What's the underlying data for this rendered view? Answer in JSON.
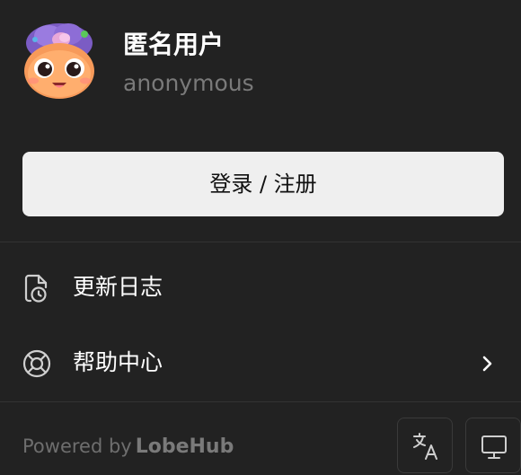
{
  "user": {
    "name": "匿名用户",
    "id": "anonymous"
  },
  "login": {
    "label": "登录 / 注册"
  },
  "menu": {
    "items": [
      {
        "label": "更新日志",
        "icon": "changelog-icon"
      },
      {
        "label": "帮助中心",
        "icon": "lifebuoy-icon",
        "submenu": true
      }
    ]
  },
  "footer": {
    "powered_prefix": "Powered by",
    "brand": "LobeHub"
  },
  "colors": {
    "background": "#222222",
    "button": "#efefef",
    "muted_text": "#7a7a7a"
  }
}
